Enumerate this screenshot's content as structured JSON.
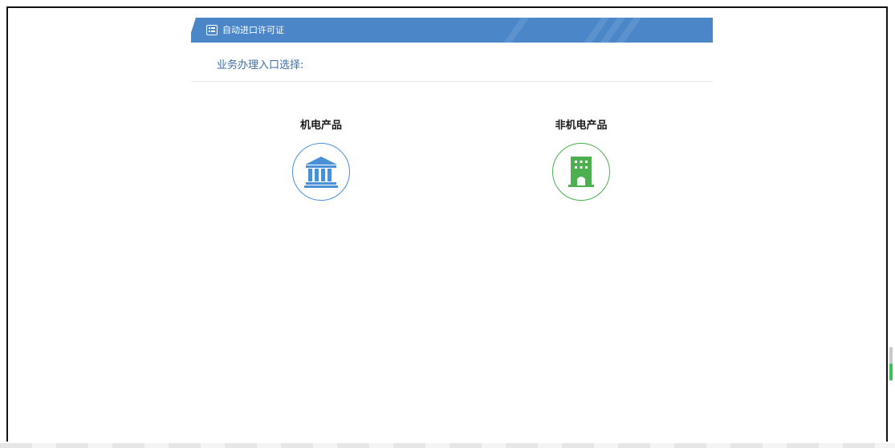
{
  "panel": {
    "title": "自动进口许可证",
    "header_color": "#4a86c8"
  },
  "entry": {
    "label": "业务办理入口选择:"
  },
  "options": [
    {
      "label": "机电产品",
      "icon": "bank-building-icon",
      "color": "#4a90d6"
    },
    {
      "label": "非机电产品",
      "icon": "office-building-icon",
      "color": "#4caf50"
    }
  ]
}
